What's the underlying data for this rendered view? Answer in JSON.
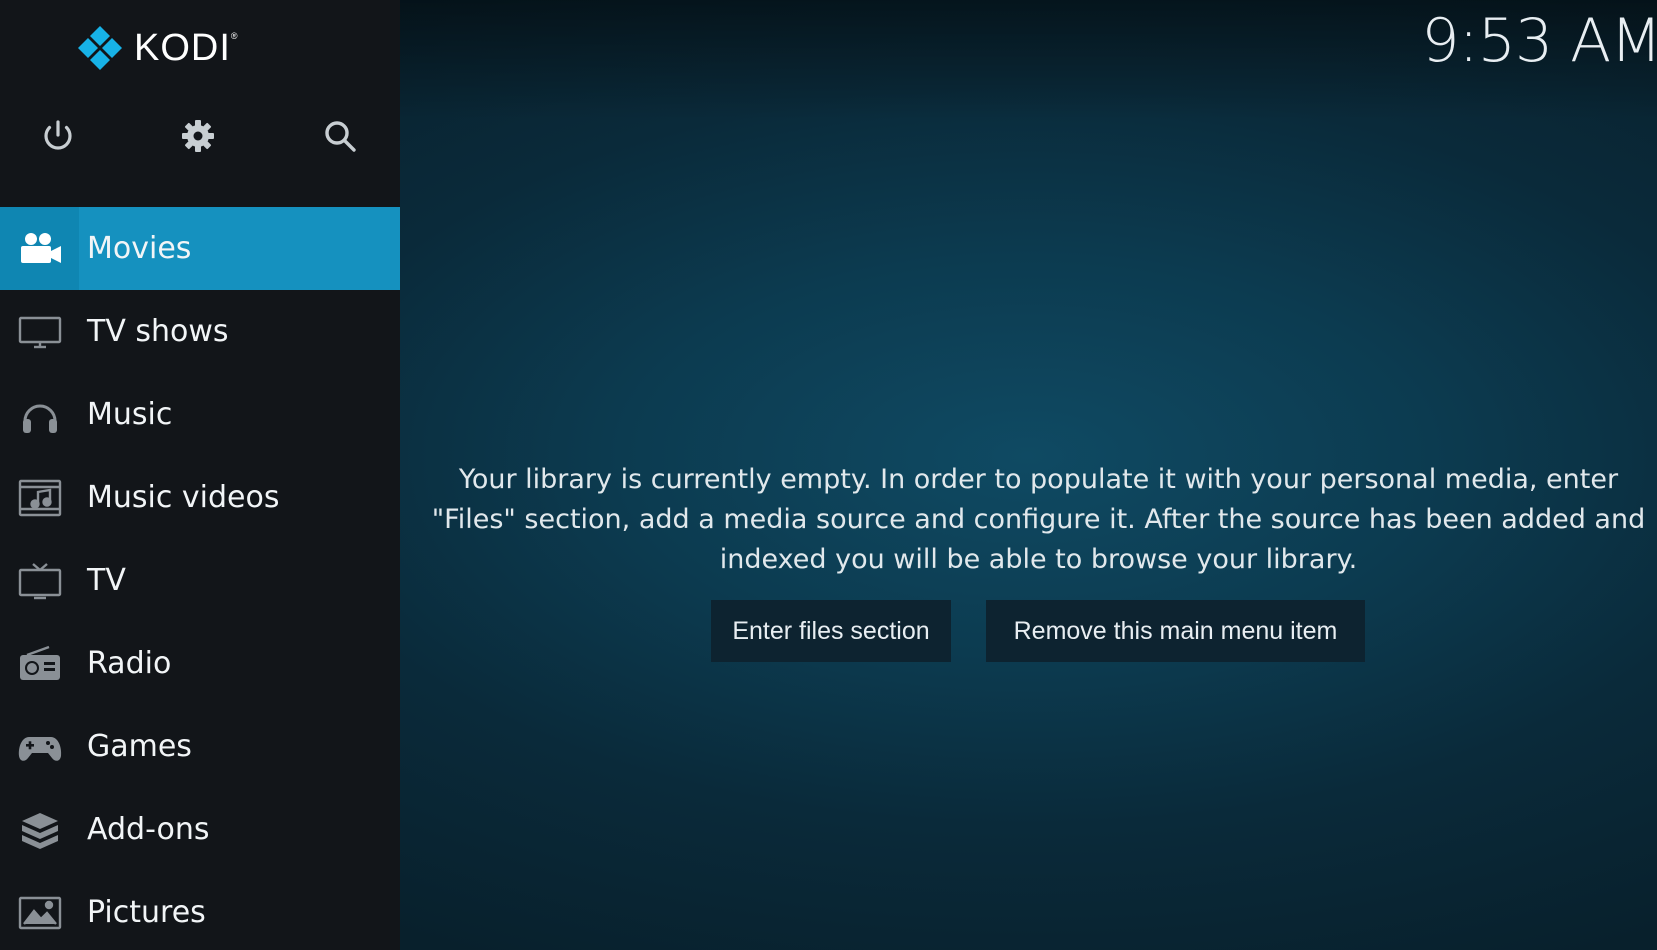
{
  "app": {
    "name": "KODI",
    "trademark": "®",
    "clock": "9:53 AM",
    "accent_color": "#1591bf"
  },
  "top_icons": [
    {
      "name": "power-icon"
    },
    {
      "name": "settings-icon"
    },
    {
      "name": "search-icon"
    }
  ],
  "menu": {
    "items": [
      {
        "label": "Movies",
        "icon": "movie-camera-icon",
        "active": true
      },
      {
        "label": "TV shows",
        "icon": "monitor-icon",
        "active": false
      },
      {
        "label": "Music",
        "icon": "headphones-icon",
        "active": false
      },
      {
        "label": "Music videos",
        "icon": "music-video-icon",
        "active": false
      },
      {
        "label": "TV",
        "icon": "tv-icon",
        "active": false
      },
      {
        "label": "Radio",
        "icon": "radio-icon",
        "active": false
      },
      {
        "label": "Games",
        "icon": "gamepad-icon",
        "active": false
      },
      {
        "label": "Add-ons",
        "icon": "addons-box-icon",
        "active": false
      },
      {
        "label": "Pictures",
        "icon": "picture-icon",
        "active": false
      }
    ]
  },
  "content": {
    "message": "Your library is currently empty. In order to populate it with your personal media, enter \"Files\" section, add a media source and configure it. After the source has been added and indexed you will be able to browse your library.",
    "buttons": {
      "enter_files": "Enter files section",
      "remove_item": "Remove this main menu item"
    }
  }
}
